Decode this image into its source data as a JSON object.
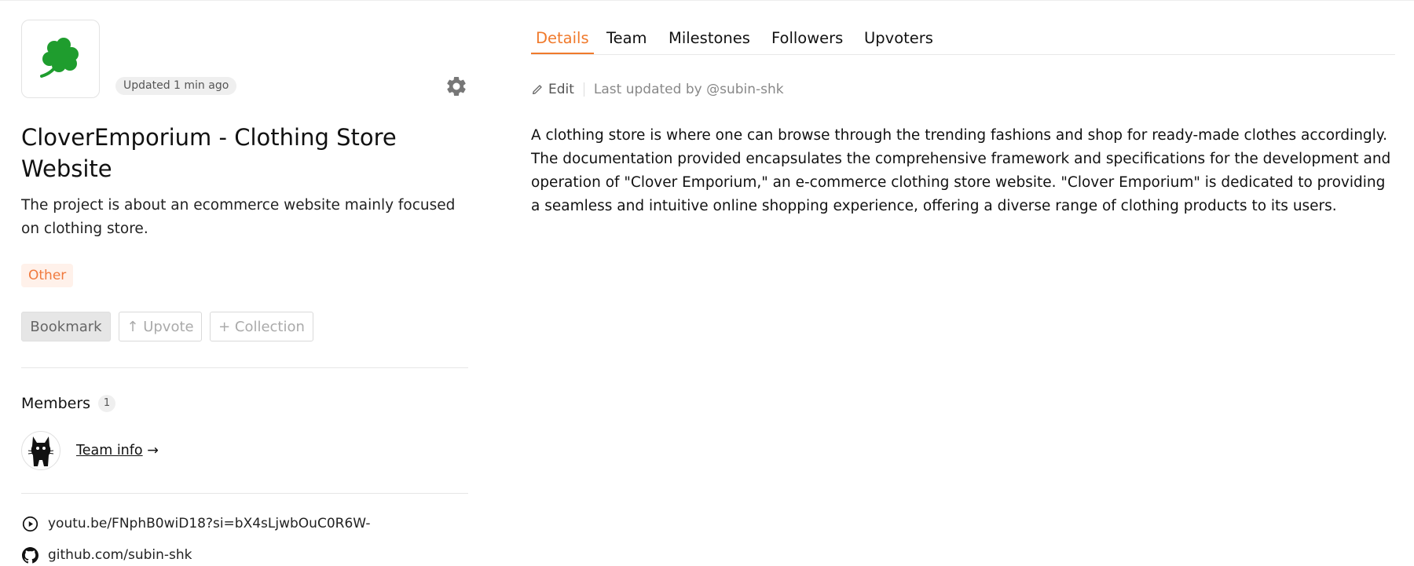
{
  "project": {
    "updated": "Updated 1 min ago",
    "title": "CloverEmporium - Clothing Store Website",
    "description": "The project is about an ecommerce website mainly focused on clothing store.",
    "tag": "Other"
  },
  "actions": {
    "bookmark": "Bookmark",
    "upvote": "↑ Upvote",
    "collection": "+ Collection"
  },
  "members": {
    "heading": "Members",
    "count": "1",
    "team_info": "Team info",
    "arrow": "→"
  },
  "links": [
    {
      "icon": "play-circle-icon",
      "text": "youtu.be/FNphB0wiD18?si=bX4sLjwbOuC0R6W-"
    },
    {
      "icon": "github-icon",
      "text": "github.com/subin-shk"
    }
  ],
  "tabs": [
    "Details",
    "Team",
    "Milestones",
    "Followers",
    "Upvoters"
  ],
  "active_tab": "Details",
  "details": {
    "edit": "Edit",
    "last_updated": "Last updated by @subin-shk",
    "body": "A clothing store is where one can browse through the trending fashions and shop for ready-made clothes accordingly. The documentation provided encapsulates the comprehensive framework and specifications for the development and operation of \"Clover Emporium,\" an e-commerce clothing store website. \"Clover Emporium\" is dedicated to providing a seamless and intuitive online shopping experience, offering a diverse range of clothing products to its users."
  },
  "colors": {
    "accent": "#f07a2c",
    "tag_bg": "#fff1ea",
    "clover": "#1f9d2e"
  }
}
